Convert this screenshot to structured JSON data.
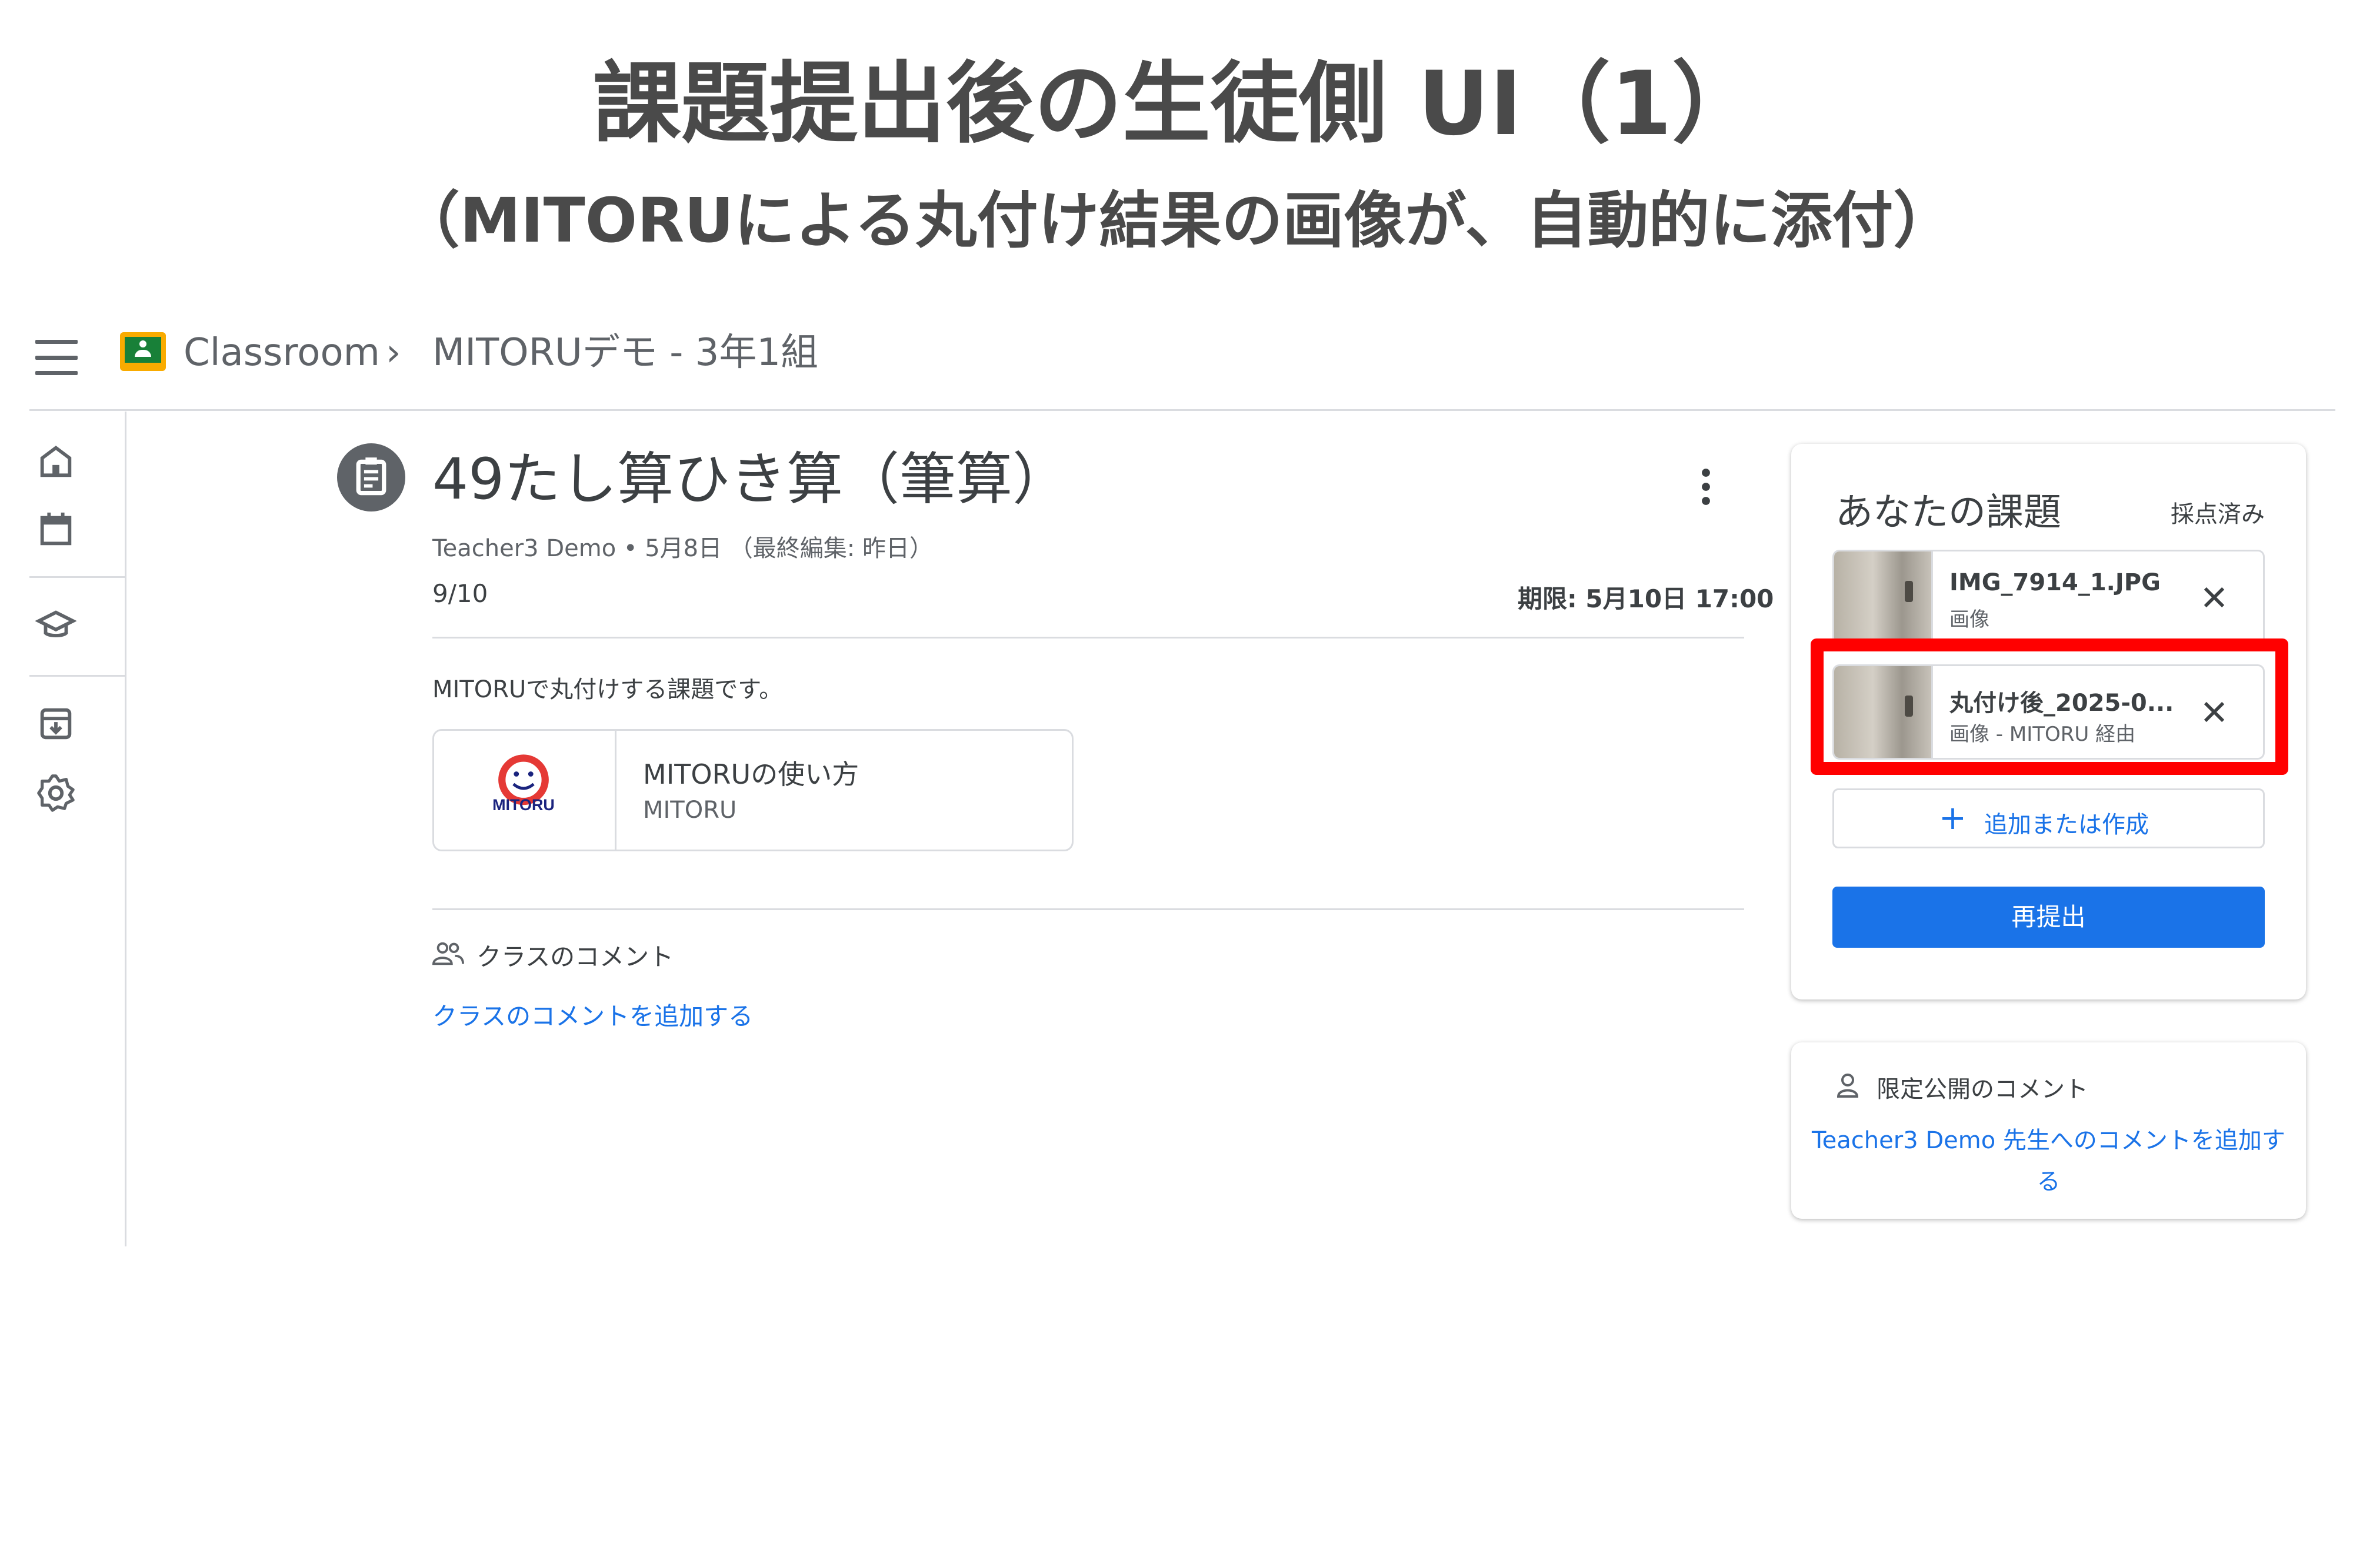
{
  "slide": {
    "title": "課題提出後の生徒側 UI（1）",
    "subtitle": "（MITORUによる丸付け結果の画像が、自動的に添付）"
  },
  "topbar": {
    "app_name": "Classroom",
    "separator": "›",
    "class_name": "MITORUデモ - 3年1組"
  },
  "rail": {
    "icons": [
      "home-icon",
      "calendar-icon",
      "enrolled-icon",
      "archive-icon",
      "settings-icon"
    ]
  },
  "assignment": {
    "title": "49たし算ひき算（筆算）",
    "meta": "Teacher3 Demo • 5月8日 （最終編集: 昨日）",
    "points": "9/10",
    "due": "期限: 5月10日 17:00",
    "description": "MITORUで丸付けする課題です。",
    "attachment": {
      "title": "MITORUの使い方",
      "source": "MITORU",
      "logo_text": "MITORU"
    },
    "class_comments_label": "クラスのコメント",
    "class_comments_link": "クラスのコメントを追加する"
  },
  "work_panel": {
    "title": "あなたの課題",
    "status": "採点済み",
    "files": [
      {
        "name": "IMG_7914_1.JPG",
        "type": "画像"
      },
      {
        "name": "丸付け後_2025-0...",
        "type": "画像 - MITORU 経由"
      }
    ],
    "add_button": "追加または作成",
    "submit_button": "再提出",
    "accent_color": "#1a73e8",
    "highlight_color": "#ff0000"
  },
  "private_comments": {
    "label": "限定公開のコメント",
    "link": "Teacher3 Demo 先生へのコメントを追加する"
  }
}
